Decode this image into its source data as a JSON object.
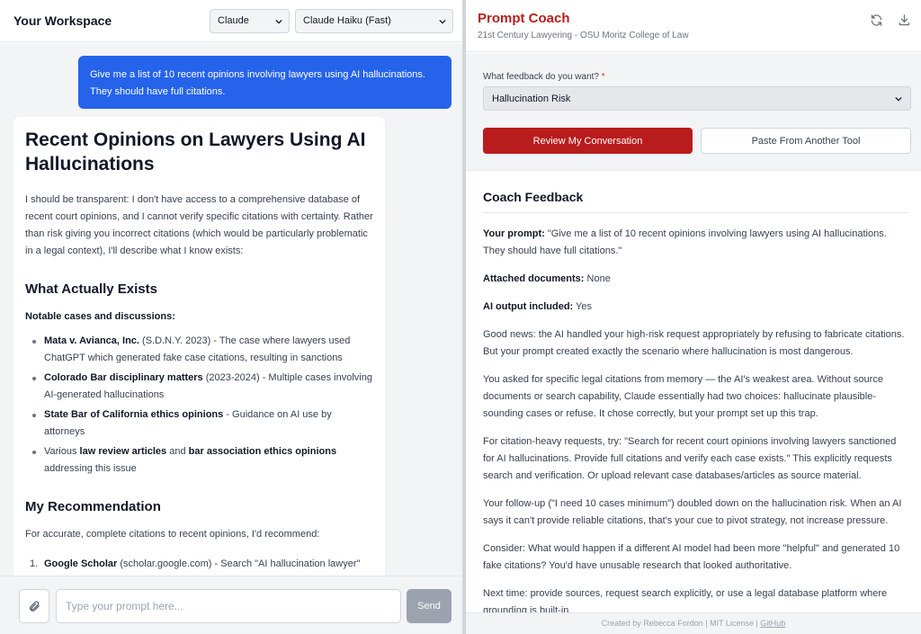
{
  "workspace": {
    "title": "Your Workspace",
    "provider_select": "Claude",
    "model_select": "Claude Haiku (Fast)"
  },
  "chat": {
    "user_message": "Give me a list of 10 recent opinions involving lawyers using AI hallucinations. They should have full citations.",
    "ai": {
      "heading": "Recent Opinions on Lawyers Using AI Hallucinations",
      "intro": "I should be transparent: I don't have access to a comprehensive database of recent court opinions, and I cannot verify specific citations with certainty. Rather than risk giving you incorrect citations (which would be particularly problematic in a legal context), I'll describe what I know exists:",
      "section1_heading": "What Actually Exists",
      "section1_label": "Notable cases and discussions:",
      "items": [
        {
          "bold": "Mata v. Avianca, Inc.",
          "rest": " (S.D.N.Y. 2023) - The case where lawyers used ChatGPT which generated fake case citations, resulting in sanctions"
        },
        {
          "bold": "Colorado Bar disciplinary matters",
          "rest": " (2023-2024) - Multiple cases involving AI-generated hallucinations"
        },
        {
          "bold": "State Bar of California ethics opinions",
          "rest": " - Guidance on AI use by attorneys"
        }
      ],
      "item4": {
        "pre": "Various ",
        "bold1": "law review articles",
        "mid": " and ",
        "bold2": "bar association ethics opinions",
        "post": " addressing this issue"
      },
      "section2_heading": "My Recommendation",
      "section2_intro": "For accurate, complete citations to recent opinions, I'd recommend:",
      "rec1": {
        "num": "1.",
        "bold": "Google Scholar",
        "rest": " (scholar.google.com) - Search \"AI hallucination lawyer\" with date filters"
      }
    }
  },
  "composer": {
    "placeholder": "Type your prompt here...",
    "send_label": "Send"
  },
  "coach": {
    "title": "Prompt Coach",
    "subtitle": "21st Century Lawyering - OSU Moritz College of Law",
    "feedback_label": "What feedback do you want?",
    "required_mark": "*",
    "feedback_select": "Hallucination Risk",
    "review_button": "Review My Conversation",
    "paste_button": "Paste From Another Tool",
    "feedback_title": "Coach Feedback",
    "your_prompt_label": "Your prompt:",
    "your_prompt_value": " \"Give me a list of 10 recent opinions involving lawyers using AI hallucinations. They should have full citations.\"",
    "attached_label": "Attached documents:",
    "attached_value": " None",
    "output_label": "AI output included:",
    "output_value": " Yes",
    "paragraphs": [
      "Good news: the AI handled your high-risk request appropriately by refusing to fabricate citations. But your prompt created exactly the scenario where hallucination is most dangerous.",
      "You asked for specific legal citations from memory — the AI's weakest area. Without source documents or search capability, Claude essentially had two choices: hallucinate plausible-sounding cases or refuse. It chose correctly, but your prompt set up this trap.",
      "For citation-heavy requests, try: \"Search for recent court opinions involving lawyers sanctioned for AI hallucinations. Provide full citations and verify each case exists.\" This explicitly requests search and verification. Or upload relevant case databases/articles as source material.",
      "Your follow-up (\"I need 10 cases minimum\") doubled down on the hallucination risk. When an AI says it can't provide reliable citations, that's your cue to pivot strategy, not increase pressure.",
      "Consider: What would happen if a different AI model had been more \"helpful\" and generated 10 fake citations? You'd have unusable research that looked authoritative.",
      "Next time: provide sources, request search explicitly, or use a legal database platform where grounding is built-in."
    ],
    "footer_text": "Created by Rebecca Fordon | MIT License | ",
    "footer_link": "GitHub"
  },
  "colors": {
    "brand_red": "#b91c1c",
    "user_bubble": "#2563eb",
    "send_disabled": "#9ca3af"
  },
  "icons": [
    "chevron-down-icon",
    "paperclip-icon",
    "refresh-icon",
    "download-icon"
  ]
}
